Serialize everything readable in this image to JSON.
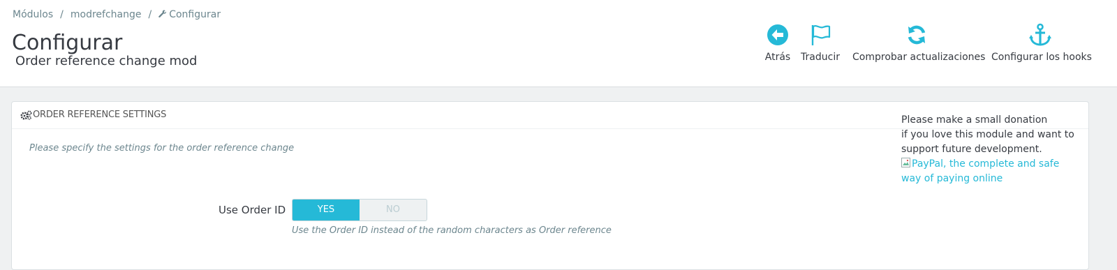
{
  "breadcrumb": {
    "items": [
      "Módulos",
      "modrefchange",
      "Configurar"
    ],
    "separator": "/"
  },
  "page": {
    "title": "Configurar",
    "subtitle": "Order reference change mod"
  },
  "toolbar": {
    "back": "Atrás",
    "translate": "Traducir",
    "check_updates": "Comprobar actualizaciones",
    "hooks": "Configurar los hooks"
  },
  "panel": {
    "title": "ORDER REFERENCE SETTINGS",
    "description": "Please specify the settings for the order reference change",
    "use_order_id": {
      "label": "Use Order ID",
      "yes": "YES",
      "no": "NO",
      "selected": "YES",
      "help": "Use the Order ID instead of the random characters as Order reference"
    }
  },
  "donation": {
    "line1": "Please make a small donation",
    "line2": "if you love this module and want to support future development.",
    "paypal_alt": "PayPal, the complete and safe way of paying online"
  },
  "colors": {
    "accent": "#25b9d7",
    "text": "#363a41",
    "muted": "#6c868e",
    "background": "#eff1f2"
  }
}
